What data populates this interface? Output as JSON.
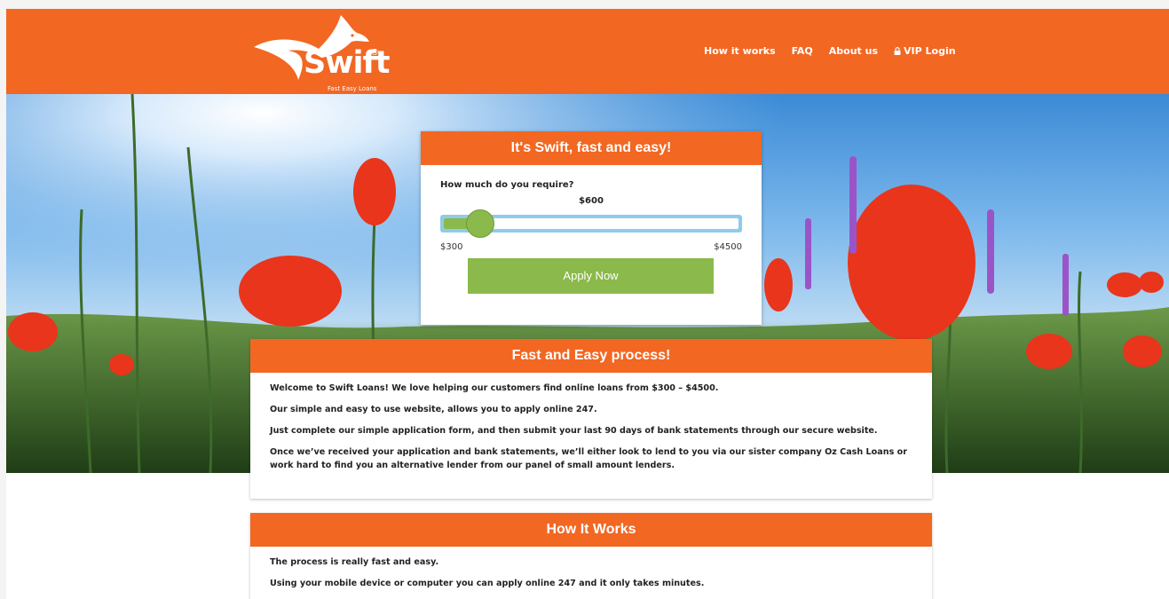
{
  "brand": {
    "name": "Swift",
    "tagline": "Fast Easy Loans",
    "registered": "®"
  },
  "nav": {
    "items": [
      {
        "label": "How it works"
      },
      {
        "label": "FAQ"
      },
      {
        "label": "About us"
      },
      {
        "label": "VIP Login",
        "icon": "lock-icon"
      }
    ]
  },
  "calculator": {
    "title": "It's Swift, fast and easy!",
    "question": "How much do you require?",
    "value": "$600",
    "min_label": "$300",
    "max_label": "$4500",
    "slider": {
      "min": 300,
      "max": 4500,
      "value": 600
    },
    "apply_label": "Apply Now"
  },
  "fast_process": {
    "title": "Fast and Easy process!",
    "paragraphs": [
      "Welcome to Swift Loans! We love helping our customers find online loans from $300 – $4500.",
      "Our simple and easy to use website, allows you to apply online 247.",
      "Just complete our simple application form, and then submit your last 90 days of bank statements through our secure website.",
      "Once we’ve received your application and bank statements, we’ll either look to lend to you via our sister company Oz Cash Loans or work hard to find you an alternative lender from our panel of small amount lenders."
    ]
  },
  "how_it_works": {
    "title": "How It Works",
    "paragraphs": [
      "The process is really fast and easy.",
      "Using your mobile device or computer you can apply online 247 and it only takes minutes."
    ]
  },
  "colors": {
    "brand_orange": "#f26722",
    "apply_green": "#8bb94b",
    "slider_blue": "#8fcbea"
  }
}
